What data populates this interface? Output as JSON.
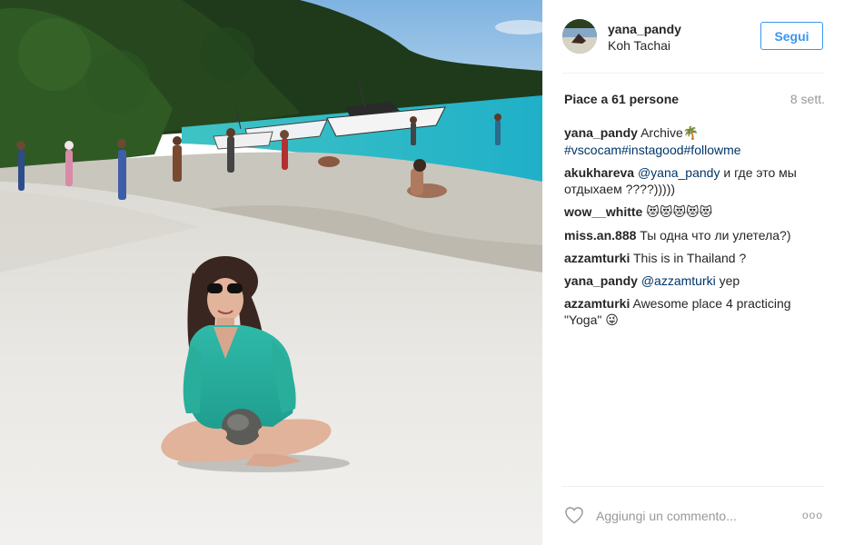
{
  "post": {
    "username": "yana_pandy",
    "location": "Koh Tachai",
    "follow_label": "Segui",
    "likes": "Piace a 61 persone",
    "time": "8 sett."
  },
  "comments": [
    {
      "user": "yana_pandy",
      "text": "Archive",
      "emoji": "🌴",
      "hashtags": "#vscocam#instagood#followme"
    },
    {
      "user": "akukhareva",
      "mention": "@yana_pandy",
      "text": "и где это мы отдыхаем ????)))))"
    },
    {
      "user": "wow__whitte",
      "emoji": "😻😻😻😻😻"
    },
    {
      "user": "miss.an.888",
      "text": "Ты одна что ли улетела?)"
    },
    {
      "user": "azzamturki",
      "text": "This is in Thailand ?"
    },
    {
      "user": "yana_pandy",
      "mention": "@azzamturki",
      "text": "yep"
    },
    {
      "user": "azzamturki",
      "text": "Awesome place 4 practicing \"Yoga\"",
      "emoji": "😜"
    }
  ],
  "footer": {
    "comment_placeholder": "Aggiungi un commento...",
    "more_label": "ooo",
    "like_icon": "heart-icon"
  },
  "colors": {
    "accent": "#3897f0",
    "link": "#003569",
    "muted": "#999999",
    "text": "#262626"
  }
}
